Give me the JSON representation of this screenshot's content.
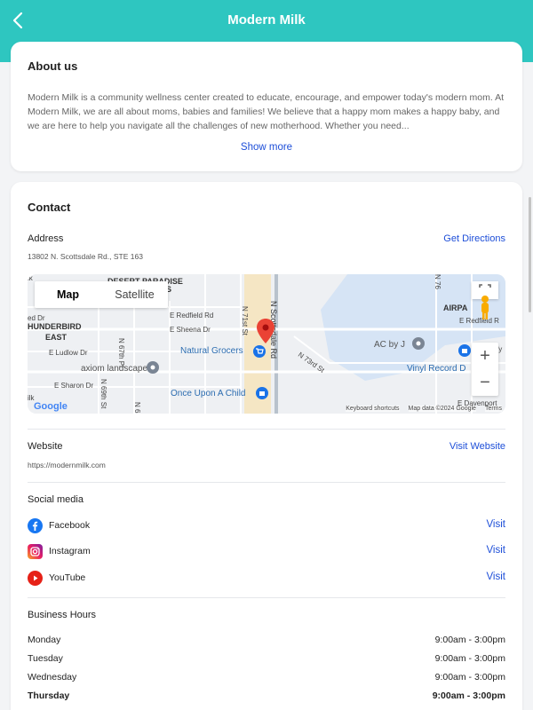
{
  "header": {
    "title": "Modern Milk"
  },
  "about": {
    "title": "About us",
    "text": "Modern Milk is a community wellness center created to educate, encourage, and empower today's modern mom. At Modern Milk, we are all about moms, babies and families! We believe that a happy mom makes a happy baby, and we are here to help you navigate all the challenges of new motherhood. Whether you need...",
    "show_more": "Show more"
  },
  "contact": {
    "title": "Contact",
    "address_label": "Address",
    "address_value": "13802 N. Scottsdale Rd., STE 163",
    "directions": "Get Directions",
    "map": {
      "tab_map": "Map",
      "tab_satellite": "Satellite",
      "zoom_in": "+",
      "zoom_out": "−",
      "attribution_keyboard": "Keyboard shortcuts",
      "attribution_data": "Map data ©2024 Google",
      "attribution_terms": "Terms",
      "logo": "Google",
      "labels": {
        "desert_paradise": "DESERT PARADISE",
        "es": "ES",
        "airpa": "AIRPA",
        "thunderbird": "HUNDERBIRD",
        "east": "EAST",
        "e_redfield": "E Redfield Rd",
        "e_redfield_right": "E Redfield R",
        "e_sheena": "E Sheena Dr",
        "e_ludlow": "E Ludlow Dr",
        "e_sharon": "E Sharon Dr",
        "n_scottsdale": "N Scottsdale Rd",
        "n_71st": "N 71st St",
        "n_67th": "N 67th Pl",
        "n_68": "N 68",
        "n_69th": "N 69th St",
        "n_73rd": "N 73rd St",
        "n_76": "N 76",
        "e_davenport": "E Davenport",
        "lk": "lk",
        "ilk": "ilk",
        "ed_dr": "ed Dr",
        "pfy": "fy",
        "natural_grocers": "Natural Grocers",
        "axiom": "axiom landscape",
        "once_upon": "Once Upon A Child",
        "ac_by_j": "AC by J",
        "vinyl_record": "Vinyl Record D"
      }
    },
    "website_label": "Website",
    "website_value": "https://modernmilk.com",
    "website_link": "Visit Website",
    "social_title": "Social media",
    "social": [
      {
        "name": "Facebook",
        "link": "Visit"
      },
      {
        "name": "Instagram",
        "link": "Visit"
      },
      {
        "name": "YouTube",
        "link": "Visit"
      }
    ],
    "hours_title": "Business Hours",
    "hours": [
      {
        "day": "Monday",
        "time": "9:00am - 3:00pm"
      },
      {
        "day": "Tuesday",
        "time": "9:00am - 3:00pm"
      },
      {
        "day": "Wednesday",
        "time": "9:00am - 3:00pm"
      },
      {
        "day": "Thursday",
        "time": "9:00am - 3:00pm"
      }
    ]
  },
  "colors": {
    "header": "#2ec6c0",
    "link": "#1d4ed8",
    "facebook": "#1877f2",
    "youtube": "#e62117",
    "pin": "#ea4335"
  }
}
